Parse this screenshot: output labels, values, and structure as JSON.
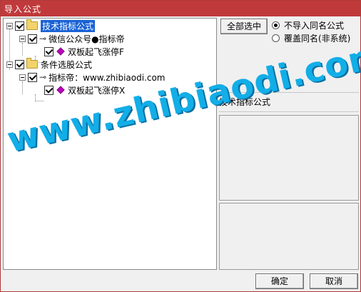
{
  "window": {
    "title": "导入公式"
  },
  "tree": {
    "nodes": [
      {
        "label": "技术指标公式",
        "selected": true
      },
      {
        "label": "微信公众号●指标帝"
      },
      {
        "label": "双板起飞涨停F"
      },
      {
        "label": "条件选股公式"
      },
      {
        "label": "指标帝：www.zhibiaodi.com"
      },
      {
        "label": "双板起飞涨停X"
      }
    ]
  },
  "right": {
    "select_all_label": "全部选中",
    "radio_options": [
      {
        "label": "不导入同名公式",
        "checked": true
      },
      {
        "label": "覆盖同名(非系统)",
        "checked": false
      }
    ],
    "formula_type_label": "技术指标公式"
  },
  "footer": {
    "ok_label": "确定",
    "cancel_label": "取消"
  },
  "watermark": {
    "text": "www.zhibiaodi.com"
  },
  "colors": {
    "titlebar": "#c0393b",
    "selection": "#1a63d6",
    "watermark": "#12aee8"
  }
}
